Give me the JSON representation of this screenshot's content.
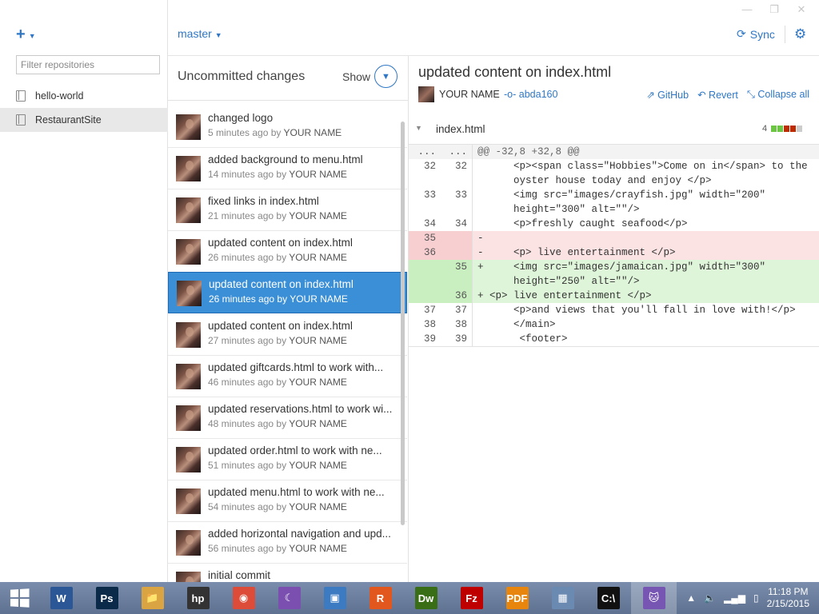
{
  "window": {
    "minimize": "—",
    "restore": "❐",
    "close": "✕"
  },
  "sidebar": {
    "add_label": "+",
    "filter_placeholder": "Filter repositories",
    "repos": [
      {
        "label": "hello-world",
        "selected": false
      },
      {
        "label": "RestaurantSite",
        "selected": true
      }
    ]
  },
  "header": {
    "branch": "master",
    "sync_label": "Sync"
  },
  "history": {
    "uncommitted_label": "Uncommitted changes",
    "show_label": "Show",
    "commits": [
      {
        "message": "changed logo",
        "time": "5 minutes ago by",
        "author": "YOUR NAME"
      },
      {
        "message": "added background to menu.html",
        "time": "14 minutes ago by",
        "author": "YOUR NAME"
      },
      {
        "message": "fixed links in index.html",
        "time": "21 minutes ago by",
        "author": "YOUR NAME"
      },
      {
        "message": "updated content on index.html",
        "time": "26 minutes ago by",
        "author": "YOUR NAME"
      },
      {
        "message": "updated content on index.html",
        "time": "26 minutes ago by",
        "author": "YOUR NAME"
      },
      {
        "message": "updated content on index.html",
        "time": "27 minutes ago by",
        "author": "YOUR NAME"
      },
      {
        "message": "updated giftcards.html to work with...",
        "time": "46 minutes ago by",
        "author": "YOUR NAME"
      },
      {
        "message": "updated reservations.html to work wi...",
        "time": "48 minutes ago by",
        "author": "YOUR NAME"
      },
      {
        "message": " updated order.html to work with ne...",
        "time": "51 minutes ago by",
        "author": "YOUR NAME"
      },
      {
        "message": "updated menu.html to work with ne...",
        "time": "54 minutes ago by",
        "author": "YOUR NAME"
      },
      {
        "message": "added horizontal navigation and upd...",
        "time": "56 minutes ago by",
        "author": "YOUR NAME"
      },
      {
        "message": "initial commit",
        "time": "",
        "author": ""
      }
    ]
  },
  "detail": {
    "title": "updated content on index.html",
    "author": "YOUR NAME",
    "sha": "abda160",
    "actions": {
      "github": "GitHub",
      "revert": "Revert",
      "collapse": "Collapse all"
    },
    "file": {
      "name": "index.html",
      "change_count": "4",
      "colors": {
        "added": "#6cc644",
        "deleted": "#bd2c00",
        "neutral": "#ccc"
      }
    },
    "diff": [
      {
        "type": "hunk",
        "old": "...",
        "new": "...",
        "code": "@@ -32,8 +32,8 @@"
      },
      {
        "type": "ctx",
        "old": "32",
        "new": "32",
        "code": "      <p><span class=\"Hobbies\">Come on in</span> to the"
      },
      {
        "type": "ctx",
        "old": "",
        "new": "",
        "code": "      oyster house today and enjoy </p>"
      },
      {
        "type": "ctx",
        "old": "33",
        "new": "33",
        "code": "      <img src=\"images/crayfish.jpg\" width=\"200\""
      },
      {
        "type": "ctx",
        "old": "",
        "new": "",
        "code": "      height=\"300\" alt=\"\"/>"
      },
      {
        "type": "ctx",
        "old": "34",
        "new": "34",
        "code": "      <p>freshly caught seafood</p>"
      },
      {
        "type": "del",
        "old": "35",
        "new": "",
        "code": "-"
      },
      {
        "type": "del",
        "old": "36",
        "new": "",
        "code": "-     <p> live entertainment </p>"
      },
      {
        "type": "add",
        "old": "",
        "new": "35",
        "code": "+     <img src=\"images/jamaican.jpg\" width=\"300\""
      },
      {
        "type": "add",
        "old": "",
        "new": "",
        "code": "      height=\"250\" alt=\"\"/>"
      },
      {
        "type": "add",
        "old": "",
        "new": "36",
        "code": "+ <p> live entertainment </p>"
      },
      {
        "type": "ctx",
        "old": "37",
        "new": "37",
        "code": "      <p>and views that you'll fall in love with!</p>"
      },
      {
        "type": "ctx",
        "old": "38",
        "new": "38",
        "code": "      </main>"
      },
      {
        "type": "ctx",
        "old": "39",
        "new": "39",
        "code": "       <footer>"
      }
    ]
  },
  "taskbar": {
    "apps": [
      {
        "name": "word-icon",
        "label": "W",
        "color": "#2b5797"
      },
      {
        "name": "photoshop-icon",
        "label": "Ps",
        "color": "#0b2a4a"
      },
      {
        "name": "file-explorer-icon",
        "label": "📁",
        "color": "#d9a441"
      },
      {
        "name": "hp-icon",
        "label": "hp",
        "color": "#333"
      },
      {
        "name": "chrome-icon",
        "label": "◉",
        "color": "#dd4b39"
      },
      {
        "name": "bittorrent-icon",
        "label": "☾",
        "color": "#7a4fb0"
      },
      {
        "name": "remote-desktop-icon",
        "label": "▣",
        "color": "#3c7bc2"
      },
      {
        "name": "r-app-icon",
        "label": "R",
        "color": "#e2571e"
      },
      {
        "name": "dreamweaver-icon",
        "label": "Dw",
        "color": "#3a6e16"
      },
      {
        "name": "filezilla-icon",
        "label": "Fz",
        "color": "#bf0000"
      },
      {
        "name": "pdf-icon",
        "label": "PDF",
        "color": "#e8850c"
      },
      {
        "name": "network-icon",
        "label": "▦",
        "color": "#6b8ab2"
      },
      {
        "name": "cmd-icon",
        "label": "C:\\",
        "color": "#111"
      },
      {
        "name": "github-icon",
        "label": "🐱",
        "color": "#7755b3"
      }
    ],
    "active_app": "github-icon",
    "time": "11:18 PM",
    "date": "2/15/2015"
  }
}
